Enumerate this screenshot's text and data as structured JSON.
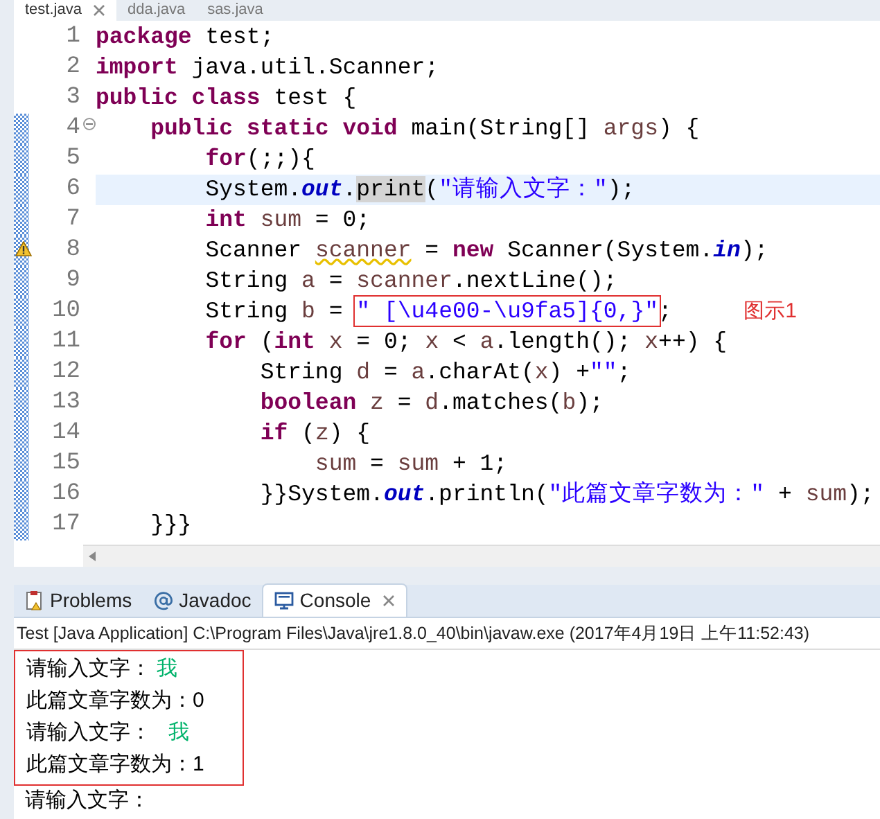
{
  "editor_tabs": [
    {
      "label": "test.java",
      "selected": true,
      "closable": true
    },
    {
      "label": "dda.java",
      "selected": false,
      "closable": false
    },
    {
      "label": "sas.java",
      "selected": false,
      "closable": false
    }
  ],
  "code_lines": [
    {
      "number": "1",
      "changed": false,
      "fold": false,
      "warning": false,
      "current": false,
      "tokens": [
        {
          "kind": "keyword",
          "text": "package"
        },
        {
          "kind": "plain",
          "text": " test;"
        }
      ]
    },
    {
      "number": "2",
      "changed": false,
      "fold": false,
      "warning": false,
      "current": false,
      "tokens": [
        {
          "kind": "keyword",
          "text": "import"
        },
        {
          "kind": "plain",
          "text": " java.util.Scanner;"
        }
      ]
    },
    {
      "number": "3",
      "changed": false,
      "fold": false,
      "warning": false,
      "current": false,
      "tokens": [
        {
          "kind": "keyword",
          "text": "public class"
        },
        {
          "kind": "plain",
          "text": " test {"
        }
      ]
    },
    {
      "number": "4",
      "changed": true,
      "fold": true,
      "warning": false,
      "current": false,
      "tokens": [
        {
          "kind": "keyword",
          "text": "    public static void"
        },
        {
          "kind": "plain",
          "text": " main(String[] "
        },
        {
          "kind": "variable",
          "text": "args"
        },
        {
          "kind": "plain",
          "text": ") {"
        }
      ]
    },
    {
      "number": "5",
      "changed": true,
      "fold": false,
      "warning": false,
      "current": false,
      "tokens": [
        {
          "kind": "keyword",
          "text": "        for"
        },
        {
          "kind": "plain",
          "text": "(;;){"
        }
      ]
    },
    {
      "number": "6",
      "changed": true,
      "fold": false,
      "warning": false,
      "current": true,
      "tokens": [
        {
          "kind": "plain",
          "text": "        System."
        },
        {
          "kind": "field",
          "text": "out"
        },
        {
          "kind": "plain",
          "text": "."
        },
        {
          "kind": "occurrence",
          "text": "print"
        },
        {
          "kind": "plain",
          "text": "("
        },
        {
          "kind": "string",
          "text": "\"请输入文字：\""
        },
        {
          "kind": "plain",
          "text": ");"
        }
      ]
    },
    {
      "number": "7",
      "changed": true,
      "fold": false,
      "warning": false,
      "current": false,
      "tokens": [
        {
          "kind": "keyword",
          "text": "        int"
        },
        {
          "kind": "variable",
          "text": " sum"
        },
        {
          "kind": "plain",
          "text": " = 0;"
        }
      ]
    },
    {
      "number": "8",
      "changed": true,
      "fold": false,
      "warning": true,
      "current": false,
      "tokens": [
        {
          "kind": "plain",
          "text": "        Scanner "
        },
        {
          "kind": "warned_variable",
          "text": "scanner"
        },
        {
          "kind": "plain",
          "text": " = "
        },
        {
          "kind": "keyword",
          "text": "new"
        },
        {
          "kind": "plain",
          "text": " Scanner(System."
        },
        {
          "kind": "field",
          "text": "in"
        },
        {
          "kind": "plain",
          "text": ");"
        }
      ]
    },
    {
      "number": "9",
      "changed": true,
      "fold": false,
      "warning": false,
      "current": false,
      "tokens": [
        {
          "kind": "plain",
          "text": "        String "
        },
        {
          "kind": "variable",
          "text": "a"
        },
        {
          "kind": "plain",
          "text": " = "
        },
        {
          "kind": "variable",
          "text": "scanner"
        },
        {
          "kind": "plain",
          "text": ".nextLine();"
        }
      ]
    },
    {
      "number": "10",
      "changed": true,
      "fold": false,
      "warning": false,
      "current": false,
      "tokens": [
        {
          "kind": "plain",
          "text": "        String "
        },
        {
          "kind": "variable",
          "text": "b"
        },
        {
          "kind": "plain",
          "text": " = "
        },
        {
          "kind": "annotated_string",
          "text": "\" [\\u4e00-\\u9fa5]{0,}\""
        },
        {
          "kind": "plain",
          "text": ";"
        }
      ],
      "annotation": "图示1"
    },
    {
      "number": "11",
      "changed": true,
      "fold": false,
      "warning": false,
      "current": false,
      "tokens": [
        {
          "kind": "keyword",
          "text": "        for"
        },
        {
          "kind": "plain",
          "text": " ("
        },
        {
          "kind": "keyword",
          "text": "int"
        },
        {
          "kind": "variable",
          "text": " x"
        },
        {
          "kind": "plain",
          "text": " = 0; "
        },
        {
          "kind": "variable",
          "text": "x"
        },
        {
          "kind": "plain",
          "text": " < "
        },
        {
          "kind": "variable",
          "text": "a"
        },
        {
          "kind": "plain",
          "text": ".length(); "
        },
        {
          "kind": "variable",
          "text": "x"
        },
        {
          "kind": "plain",
          "text": "++) {"
        }
      ]
    },
    {
      "number": "12",
      "changed": true,
      "fold": false,
      "warning": false,
      "current": false,
      "tokens": [
        {
          "kind": "plain",
          "text": "            String "
        },
        {
          "kind": "variable",
          "text": "d"
        },
        {
          "kind": "plain",
          "text": " = "
        },
        {
          "kind": "variable",
          "text": "a"
        },
        {
          "kind": "plain",
          "text": ".charAt("
        },
        {
          "kind": "variable",
          "text": "x"
        },
        {
          "kind": "plain",
          "text": ") +"
        },
        {
          "kind": "string",
          "text": "\"\""
        },
        {
          "kind": "plain",
          "text": ";"
        }
      ]
    },
    {
      "number": "13",
      "changed": true,
      "fold": false,
      "warning": false,
      "current": false,
      "tokens": [
        {
          "kind": "keyword",
          "text": "            boolean"
        },
        {
          "kind": "variable",
          "text": " z"
        },
        {
          "kind": "plain",
          "text": " = "
        },
        {
          "kind": "variable",
          "text": "d"
        },
        {
          "kind": "plain",
          "text": ".matches("
        },
        {
          "kind": "variable",
          "text": "b"
        },
        {
          "kind": "plain",
          "text": ");"
        }
      ]
    },
    {
      "number": "14",
      "changed": true,
      "fold": false,
      "warning": false,
      "current": false,
      "tokens": [
        {
          "kind": "keyword",
          "text": "            if"
        },
        {
          "kind": "plain",
          "text": " ("
        },
        {
          "kind": "variable",
          "text": "z"
        },
        {
          "kind": "plain",
          "text": ") {"
        }
      ]
    },
    {
      "number": "15",
      "changed": true,
      "fold": false,
      "warning": false,
      "current": false,
      "tokens": [
        {
          "kind": "variable",
          "text": "                sum"
        },
        {
          "kind": "plain",
          "text": " = "
        },
        {
          "kind": "variable",
          "text": "sum"
        },
        {
          "kind": "plain",
          "text": " + 1;"
        }
      ]
    },
    {
      "number": "16",
      "changed": true,
      "fold": false,
      "warning": false,
      "current": false,
      "tokens": [
        {
          "kind": "plain",
          "text": "            }}System."
        },
        {
          "kind": "field",
          "text": "out"
        },
        {
          "kind": "plain",
          "text": ".println("
        },
        {
          "kind": "string",
          "text": "\"此篇文章字数为：\""
        },
        {
          "kind": "plain",
          "text": " + "
        },
        {
          "kind": "variable",
          "text": "sum"
        },
        {
          "kind": "plain",
          "text": ");"
        }
      ]
    },
    {
      "number": "17",
      "changed": true,
      "fold": false,
      "warning": false,
      "current": false,
      "tokens": [
        {
          "kind": "plain",
          "text": "    }}}"
        }
      ]
    }
  ],
  "view_tabs": [
    {
      "label": "Problems",
      "selected": false,
      "closable": false
    },
    {
      "label": "Javadoc",
      "selected": false,
      "closable": false
    },
    {
      "label": "Console",
      "selected": true,
      "closable": true
    }
  ],
  "console": {
    "header": "Test [Java Application] C:\\Program Files\\Java\\jre1.8.0_40\\bin\\javaw.exe (2017年4月19日 上午11:52:43)",
    "lines": [
      {
        "text": "请输入文字：",
        "input": "我",
        "boxed": true
      },
      {
        "text": "此篇文章字数为：0",
        "boxed": true
      },
      {
        "text": "请输入文字：",
        "input": "  我",
        "boxed": true
      },
      {
        "text": "此篇文章字数为：1",
        "boxed": true
      },
      {
        "text": "请输入文字：",
        "boxed": false
      }
    ]
  }
}
